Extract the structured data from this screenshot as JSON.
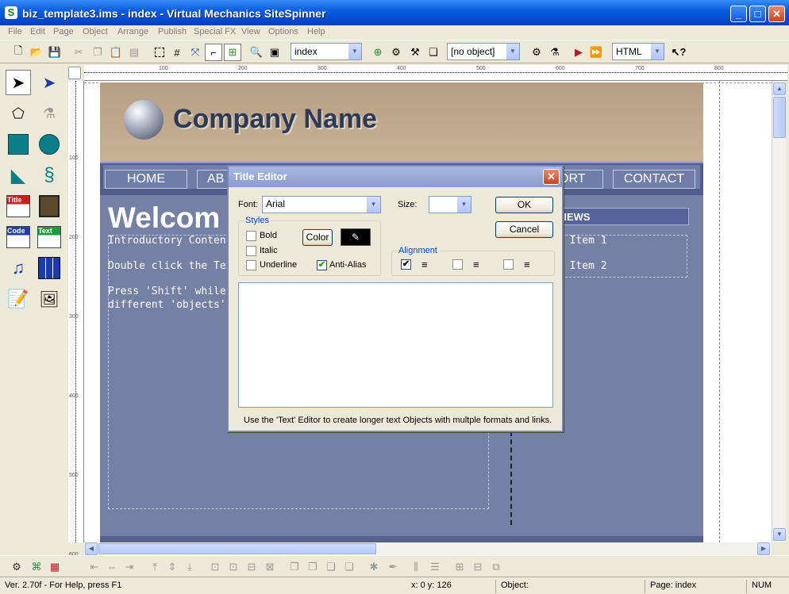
{
  "window": {
    "title": "biz_template3.ims - index - Virtual Mechanics SiteSpinner",
    "app_icon": "S",
    "minimize": "_",
    "maximize": "□",
    "close": "✕"
  },
  "menu": [
    "File",
    "Edit",
    "Page",
    "Object",
    "Arrange",
    "Publish",
    "Special FX",
    "View",
    "Options",
    "Help"
  ],
  "toolbar": {
    "page_select": "index",
    "object_select": "[no object]",
    "output_select": "HTML"
  },
  "website": {
    "company_name": "Company Name",
    "nav": [
      "HOME",
      "AB",
      "ORT",
      "CONTACT"
    ],
    "welcome": "Welcom",
    "body_lines": [
      "Introductory Content",
      "Double click the Text a",
      "Press 'Shift' while left-",
      "different 'objects' in th"
    ],
    "news_heading": "T NEWS",
    "news_items": [
      ": Item 1",
      ": Item 2"
    ]
  },
  "ruler": {
    "h": [
      "100",
      "200",
      "300",
      "400",
      "500",
      "600",
      "700",
      "800"
    ],
    "v": [
      "100",
      "200",
      "300",
      "400",
      "500",
      "600"
    ]
  },
  "dialog": {
    "title": "Title Editor",
    "font_label": "Font:",
    "font_value": "Arial",
    "size_label": "Size:",
    "size_value": "",
    "ok": "OK",
    "cancel": "Cancel",
    "styles_legend": "Styles",
    "bold": "Bold",
    "italic": "Italic",
    "underline": "Underline",
    "color_button": "Color",
    "antialias": "Anti-Alias",
    "alignment_legend": "Alignment",
    "hint": "Use the 'Text' Editor to create longer text Objects with multple formats and links.",
    "checked_mark": "✔"
  },
  "status": {
    "help": "Ver. 2.70f - For Help, press F1",
    "coords": "x: 0  y: 126",
    "object": "Object:",
    "page": "Page:  index",
    "num": "NUM"
  },
  "colors": {
    "titlebar": "#0a5fe0",
    "page_background": "#7480a4",
    "nav_band": "#4f5e8c",
    "header_band": "#c0a98c"
  }
}
